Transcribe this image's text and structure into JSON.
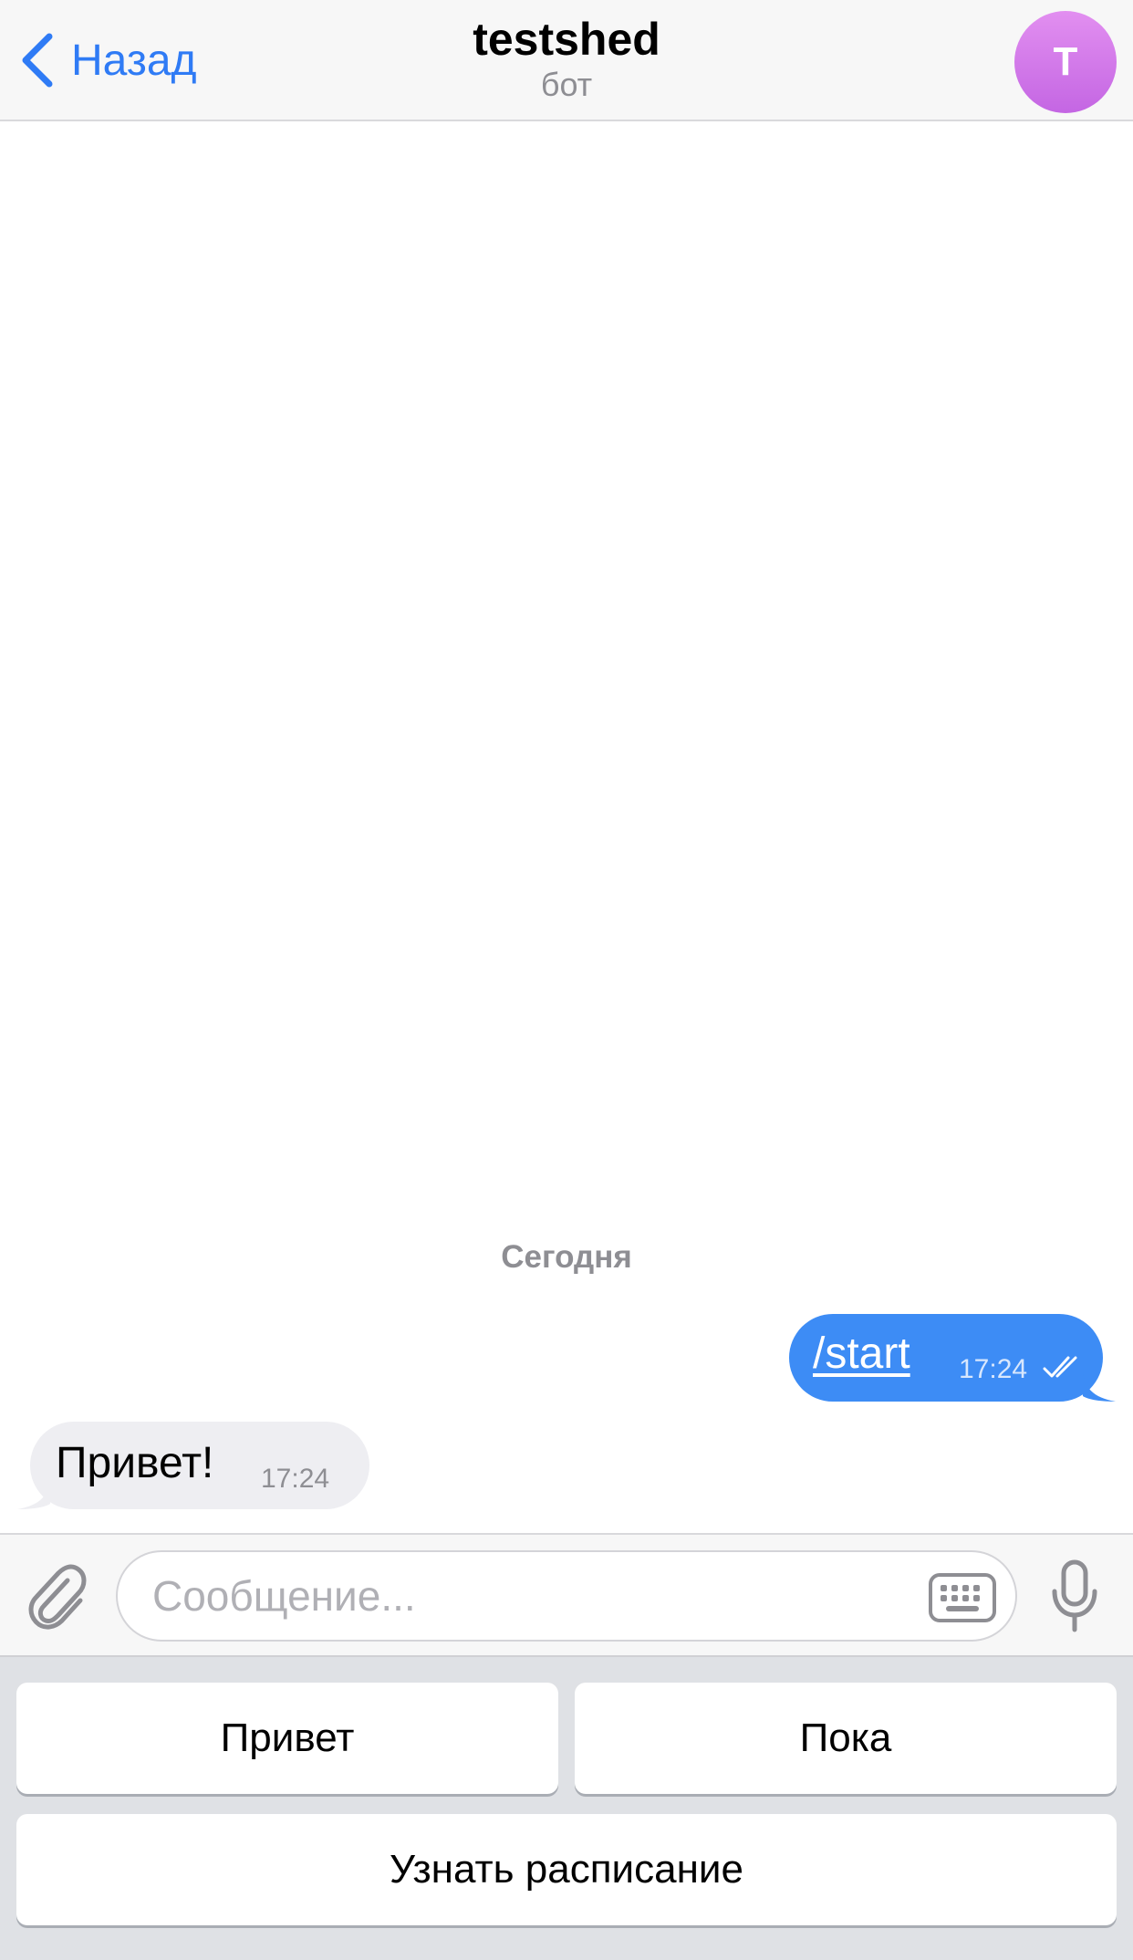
{
  "header": {
    "back_label": "Назад",
    "title": "testshed",
    "subtitle": "бот",
    "avatar_letter": "T",
    "accent": "#2f7bf5",
    "avatar_gradient": [
      "#e28ff0",
      "#c466e3"
    ]
  },
  "chat": {
    "date_separator": "Сегодня",
    "messages": [
      {
        "direction": "outgoing",
        "text": "/start",
        "time": "17:24",
        "status": "read-double-check",
        "bubble_color": "#3d8cf5"
      },
      {
        "direction": "incoming",
        "text": "Привет!",
        "time": "17:24",
        "bubble_color": "#eeeef2"
      }
    ]
  },
  "input": {
    "placeholder": "Сообщение...",
    "value": "",
    "icons": [
      "paperclip-icon",
      "keyboard-icon",
      "microphone-icon"
    ]
  },
  "reply_keyboard": {
    "rows": [
      [
        "Привет",
        "Пока"
      ],
      [
        "Узнать расписание"
      ]
    ]
  }
}
